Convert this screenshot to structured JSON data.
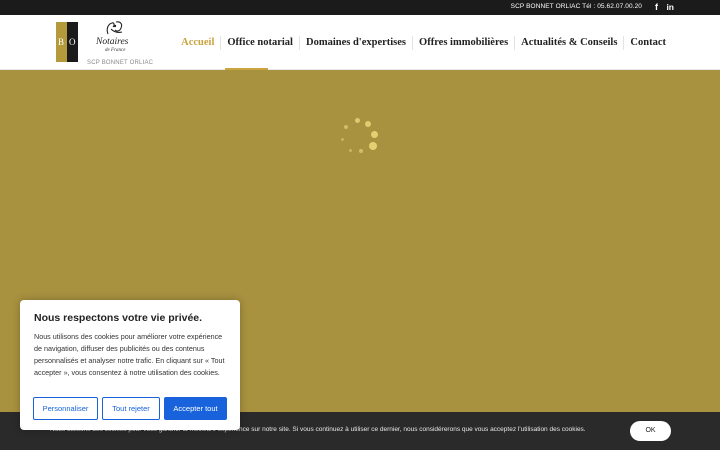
{
  "topbar": {
    "contact": "SCP BONNET ORLIAC Tél : 05.62.07.00.20",
    "facebook_icon": "f",
    "linkedin_icon": "in"
  },
  "logo": {
    "letter_b": "B",
    "letter_o": "O",
    "notaires": "Notaires",
    "de_france": "de France",
    "firm": "SCP BONNET ORLIAC"
  },
  "nav": {
    "items": [
      {
        "label": "Accueil"
      },
      {
        "label": "Office notarial"
      },
      {
        "label": "Domaines d'expertises"
      },
      {
        "label": "Offres immobilières"
      },
      {
        "label": "Actualités & Conseils"
      },
      {
        "label": "Contact"
      }
    ]
  },
  "consent": {
    "title": "Nous respectons votre vie privée.",
    "body": "Nous utilisons des cookies pour améliorer votre expérience de navigation, diffuser des publicités ou des contenus personnalisés et analyser notre trafic. En cliquant sur « Tout accepter », vous consentez à notre utilisation des cookies.",
    "customize_label": "Personnaliser",
    "reject_label": "Tout rejeter",
    "accept_label": "Accepter tout"
  },
  "cookiebar": {
    "text": "Nous utilisons des cookies pour vous garantir la meilleure expérience sur notre site. Si vous continuez à utiliser ce dernier, nous considérerons que vous acceptez l'utilisation des cookies.",
    "ok_label": "OK"
  },
  "colors": {
    "accent": "#c9a43f",
    "hero_bg": "#a8913f",
    "button_blue": "#1863dc"
  }
}
